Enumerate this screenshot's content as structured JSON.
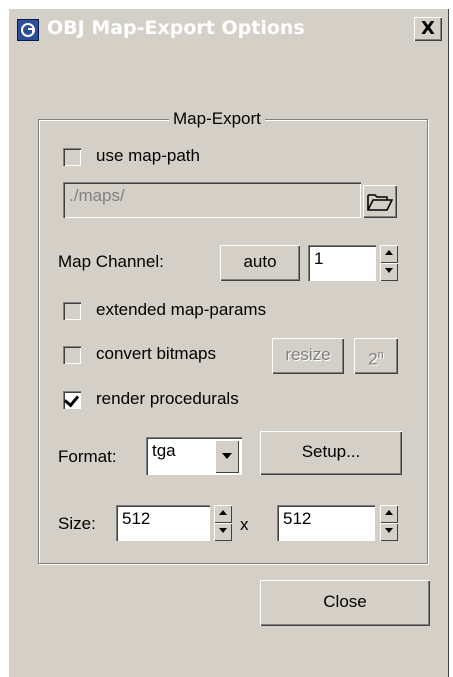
{
  "window": {
    "title": "OBJ Map-Export Options",
    "close_glyph": "X"
  },
  "group": {
    "label": "Map-Export"
  },
  "use_map_path": {
    "label": "use map-path",
    "checked": false
  },
  "map_path": {
    "value": "./maps/"
  },
  "map_channel": {
    "label": "Map Channel:",
    "auto_label": "auto",
    "value": "1"
  },
  "extended_map_params": {
    "label": "extended map-params",
    "checked": false
  },
  "convert_bitmaps": {
    "label": "convert bitmaps",
    "checked": false,
    "resize_label": "resize",
    "pow2_base": "2",
    "pow2_exp": "n"
  },
  "render_procedurals": {
    "label": "render procedurals",
    "checked": true
  },
  "format": {
    "label": "Format:",
    "value": "tga",
    "setup_label": "Setup..."
  },
  "size": {
    "label": "Size:",
    "width": "512",
    "separator": "x",
    "height": "512"
  },
  "close_button": {
    "label": "Close"
  },
  "icons": {
    "app": "app-icon",
    "folder": "folder-open-icon",
    "spin_up": "spin-up-icon",
    "spin_down": "spin-down-icon",
    "dropdown": "chevron-down-icon",
    "check": "checkmark-icon"
  },
  "colors": {
    "dialog_bg": "#d4d0c8",
    "disabled_text": "#808080",
    "title_text": "#ffffff"
  }
}
